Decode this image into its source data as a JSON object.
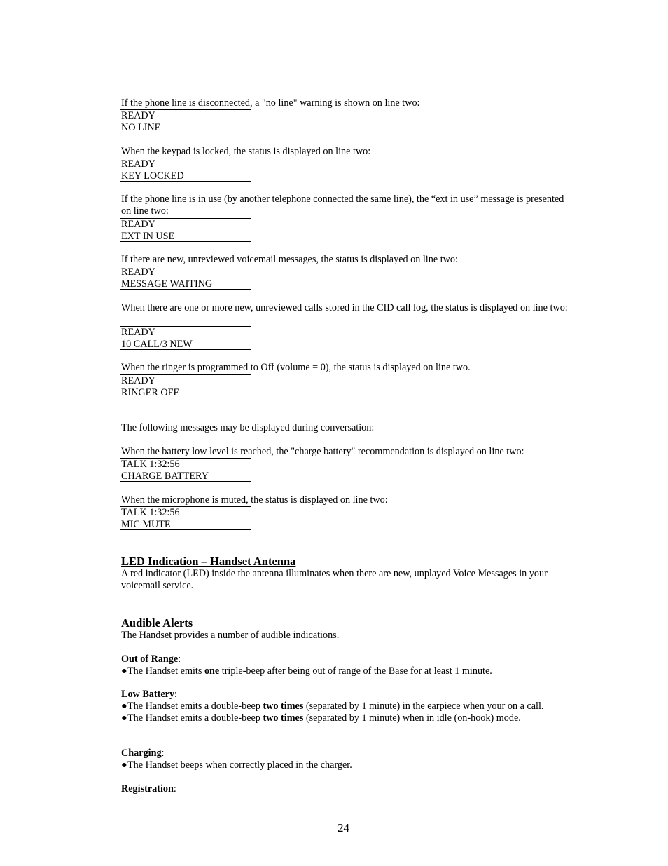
{
  "page": {
    "number": "24"
  },
  "display_intro": [
    {
      "text": "If the phone line is disconnected, a \"no line\" warning is shown on line two:",
      "line1": "READY",
      "line2": "NO LINE"
    },
    {
      "text": "When the keypad is locked, the status is displayed on line two:",
      "line1": "READY",
      "line2": "KEY LOCKED"
    },
    {
      "text": "If the phone line is in use (by another telephone connected the same line), the “ext in use” message is presented on line two:",
      "line1": "READY",
      "line2": "EXT IN USE"
    },
    {
      "text": "If there are new, unreviewed voicemail messages, the status is displayed on line two:",
      "line1": "READY",
      "line2": "MESSAGE WAITING"
    },
    {
      "text": "When there are one or more new, unreviewed calls stored in the CID call log, the status is displayed on line two:",
      "line1": "READY",
      "line2": "10 CALL/3 NEW"
    },
    {
      "text": "When the ringer is programmed to Off (volume = 0), the status is displayed on line two.",
      "line1": "READY",
      "line2": "RINGER OFF"
    }
  ],
  "conversation_intro": "The following messages may be displayed during conversation:",
  "conversation": [
    {
      "text": "When the battery low level is reached, the \"charge battery\" recommendation is displayed on line two:",
      "line1": "TALK 1:32:56",
      "line2": "CHARGE BATTERY"
    },
    {
      "text": "When the microphone is muted, the status is displayed on line two:",
      "line1": "TALK 1:32:56",
      "line2": "MIC MUTE"
    }
  ],
  "led": {
    "heading": "LED Indication – Handset Antenna",
    "body": "A red indicator (LED) inside the antenna illuminates when there are new, unplayed Voice Messages in your voicemail service."
  },
  "audible": {
    "heading": "Audible Alerts",
    "intro": "The Handset provides a number of audible indications.",
    "out_of_range": {
      "label": "Out of Range",
      "items": [
        {
          "pre": "The Handset emits ",
          "bold": "one",
          "post": " triple-beep after being out of range of the Base for at least 1 minute."
        }
      ]
    },
    "low_battery": {
      "label": "Low Battery",
      "items": [
        {
          "pre": "The Handset emits a double-beep ",
          "bold": "two times",
          "post": " (separated by 1 minute) in the earpiece when your on a call."
        },
        {
          "pre": "The Handset emits a double-beep ",
          "bold": "two times",
          "post": " (separated by 1 minute) when in idle (on-hook) mode."
        }
      ]
    },
    "charging": {
      "label": "Charging",
      "items": [
        {
          "text": "The Handset beeps when correctly placed in the charger."
        }
      ]
    },
    "registration": {
      "label": "Registration"
    },
    "colon": ":",
    "bullet": "●"
  }
}
